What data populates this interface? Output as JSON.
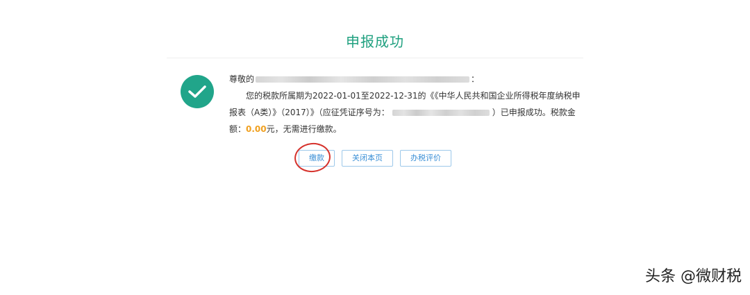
{
  "page": {
    "title": "申报成功"
  },
  "message": {
    "greeting_prefix": "尊敬的",
    "greeting_suffix": "：",
    "body_part1": "您的税款所属期为2022-01-01至2022-12-31的《《中华人民共和国企业所得税年度纳税申报表（A类）》（2017）》（应征凭证序号为：",
    "body_part2": "）已申报成功。税款金额：",
    "amount": "0.00",
    "amount_color": "#f0a020",
    "body_part3": "元，无需进行缴款。"
  },
  "buttons": {
    "pay": "缴款",
    "close": "关闭本页",
    "evaluate": "办税评价"
  },
  "status": {
    "icon": "check-icon",
    "color": "#21a58a"
  },
  "annotation": {
    "color": "#d6322c"
  },
  "watermark": {
    "text": "头条 @微财税"
  }
}
